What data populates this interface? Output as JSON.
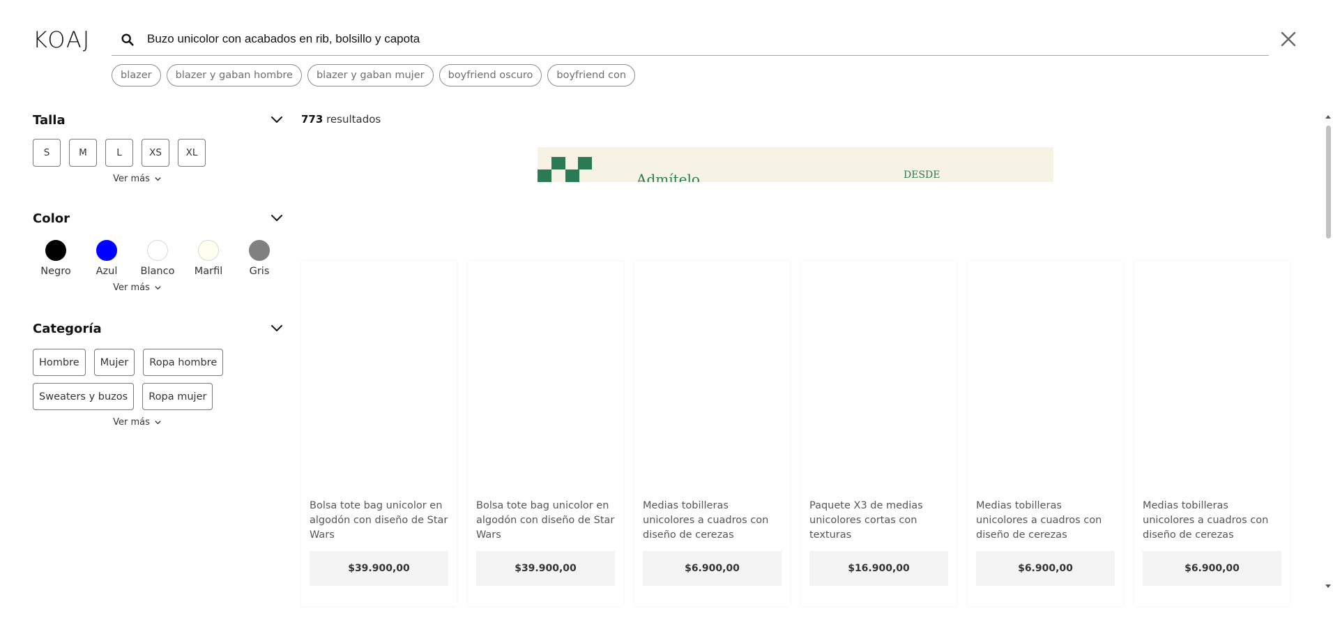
{
  "header": {
    "logo": "KOAJ",
    "search_value": "Buzo unicolor con acabados en rib, bolsillo y capota",
    "search_icon": "search-icon",
    "close_icon": "close-icon"
  },
  "suggestions": [
    "blazer",
    "blazer y gaban hombre",
    "blazer y gaban mujer",
    "boyfriend oscuro",
    "boyfriend con"
  ],
  "filters": {
    "size": {
      "title": "Talla",
      "options": [
        "S",
        "M",
        "L",
        "XS",
        "XL"
      ],
      "more_label": "Ver más"
    },
    "color": {
      "title": "Color",
      "options": [
        {
          "label": "Negro",
          "hex": "#000000"
        },
        {
          "label": "Azul",
          "hex": "#0000ff"
        },
        {
          "label": "Blanco",
          "hex": "#ffffff"
        },
        {
          "label": "Marfil",
          "hex": "#fffff0"
        },
        {
          "label": "Gris",
          "hex": "#808080"
        }
      ],
      "more_label": "Ver más"
    },
    "category": {
      "title": "Categoría",
      "options": [
        "Hombre",
        "Mujer",
        "Ropa hombre",
        "Sweaters y buzos",
        "Ropa mujer"
      ],
      "more_label": "Ver más"
    }
  },
  "results": {
    "count": "773",
    "label": "resultados"
  },
  "banner": {
    "text_left": "Admítelo",
    "text_right": "DESDE"
  },
  "products": [
    {
      "name": "Bolsa tote bag unicolor en algodón con diseño de Star Wars",
      "price": "$39.900,00"
    },
    {
      "name": "Bolsa tote bag unicolor en algodón con diseño de Star Wars",
      "price": "$39.900,00"
    },
    {
      "name": "Medias tobilleras unicolores a cuadros con diseño de cerezas",
      "price": "$6.900,00"
    },
    {
      "name": "Paquete X3 de medias unicolores cortas con texturas",
      "price": "$16.900,00"
    },
    {
      "name": "Medias tobilleras unicolores a cuadros con diseño de cerezas",
      "price": "$6.900,00"
    },
    {
      "name": "Medias tobilleras unicolores a cuadros con diseño de cerezas",
      "price": "$6.900,00"
    }
  ],
  "colors": {
    "accent_line": "#7fb9a3",
    "banner_green": "#2a7a55",
    "banner_bg": "#f7f3e4"
  }
}
